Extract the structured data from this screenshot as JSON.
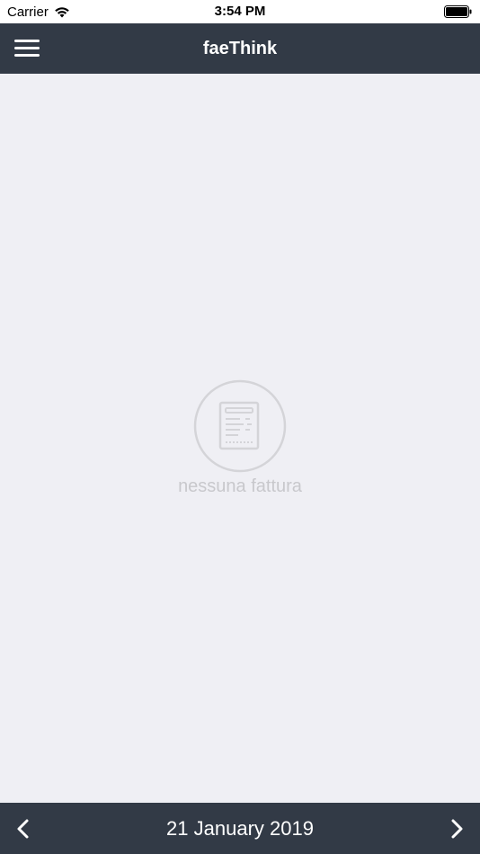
{
  "status_bar": {
    "carrier": "Carrier",
    "time": "3:54 PM"
  },
  "nav": {
    "title": "faeThink",
    "menu_icon": "hamburger-menu-icon"
  },
  "empty_state": {
    "icon": "invoice-document-icon",
    "message": "nessuna fattura"
  },
  "bottom_bar": {
    "date": "21 January 2019",
    "prev_icon": "chevron-left-icon",
    "next_icon": "chevron-right-icon"
  },
  "colors": {
    "bar_background": "#323a46",
    "content_background": "#efeff4",
    "empty_text": "#c8c8cc"
  }
}
